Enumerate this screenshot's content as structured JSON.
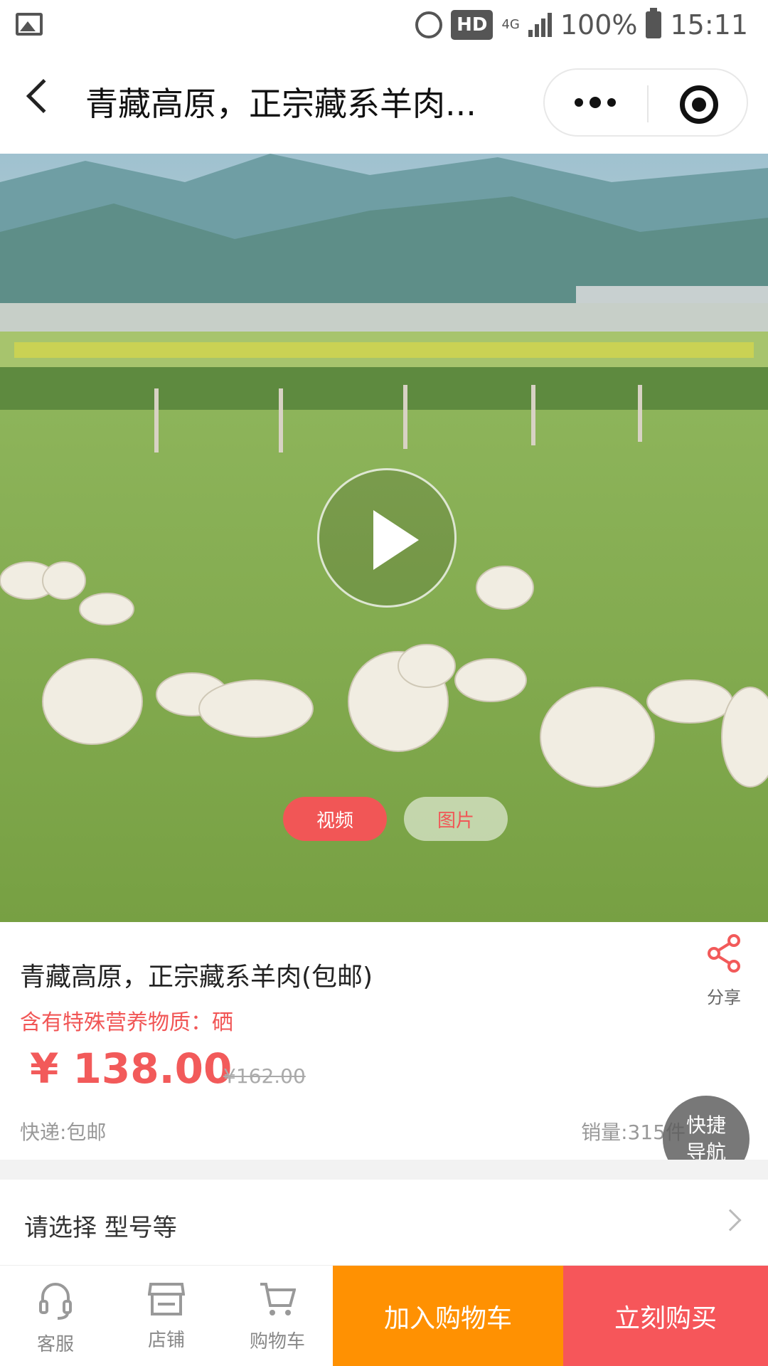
{
  "status_bar": {
    "network": "4G",
    "hd_badge": "HD",
    "battery": "100%",
    "time": "15:11"
  },
  "nav": {
    "title": "青藏高原，正宗藏系羊肉..."
  },
  "media": {
    "tabs": [
      "视频",
      "图片"
    ]
  },
  "product": {
    "title": "青藏高原，正宗藏系羊肉(包邮)",
    "subtitle": "含有特殊营养物质：硒",
    "price": "¥ 138.00",
    "original_price": "¥162.00",
    "shipping": "快递:包邮",
    "sales": "销量:315件",
    "share_label": "分享"
  },
  "quick_nav": {
    "line1": "快捷",
    "line2": "导航"
  },
  "options": {
    "label": "请选择 型号等"
  },
  "bottom_bar": {
    "service": "客服",
    "store": "店铺",
    "cart": "购物车",
    "add_to_cart": "加入购物车",
    "buy_now": "立刻购买"
  },
  "colors": {
    "accent_red": "#f25a5a",
    "cart_orange": "#ff9102",
    "buy_red": "#f6565a"
  }
}
